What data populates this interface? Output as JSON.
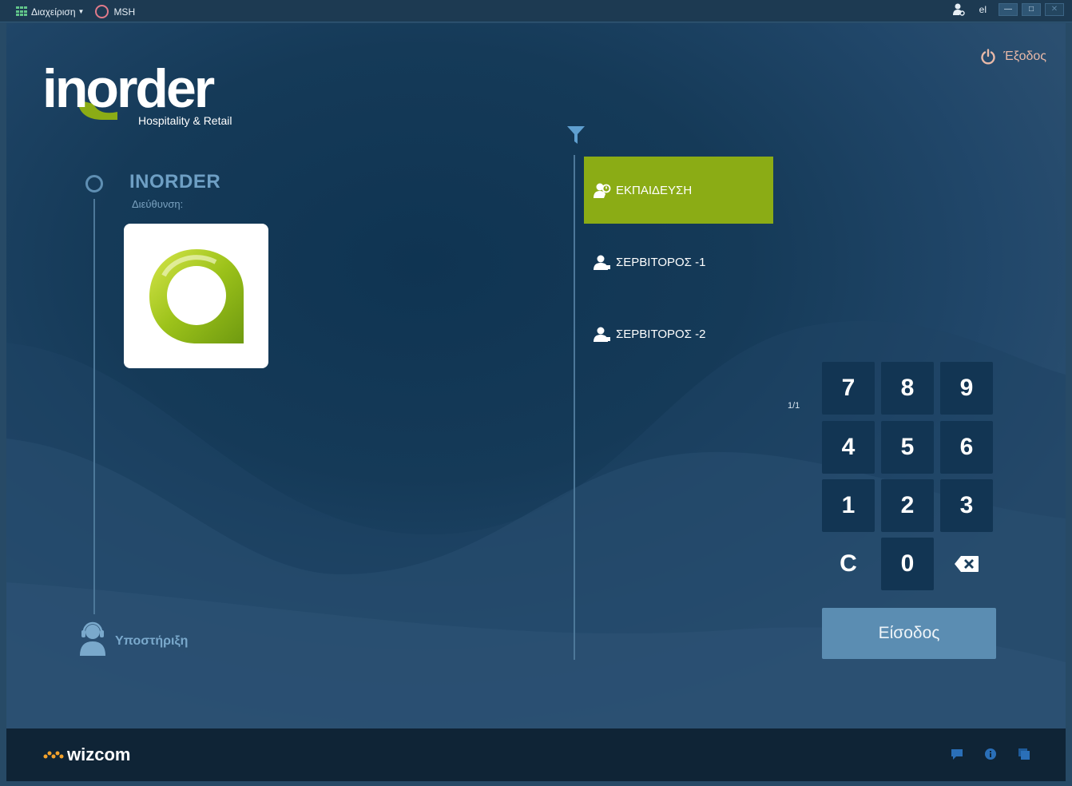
{
  "titlebar": {
    "menu_label": "Διαχείριση",
    "station_label": "MSH",
    "lang": "el",
    "minimize_symbol": "—",
    "maximize_symbol": "□",
    "close_symbol": "✕"
  },
  "brand": {
    "logo_text": "inorder",
    "logo_subtitle": "Hospitality & Retail",
    "accent_color": "#8bac15"
  },
  "header": {
    "exit_label": "Έξοδος"
  },
  "company": {
    "name": "INORDER",
    "address_label": "Διεύθυνση:"
  },
  "support": {
    "label": "Υποστήριξη"
  },
  "users": {
    "items": [
      {
        "label": "ΕΚΠΑΙΔΕΥΣΗ",
        "icon": "trainer-user-icon",
        "selected": true
      },
      {
        "label": "ΣΕΡΒΙΤΟΡΟΣ -1",
        "icon": "user-icon",
        "selected": false
      },
      {
        "label": "ΣΕΡΒΙΤΟΡΟΣ -2",
        "icon": "user-icon",
        "selected": false
      }
    ],
    "page_indicator": "1/1"
  },
  "numpad": {
    "keys": [
      "7",
      "8",
      "9",
      "4",
      "5",
      "6",
      "1",
      "2",
      "3",
      "C",
      "0"
    ],
    "backspace_icon": "backspace-icon"
  },
  "login": {
    "label": "Είσοδος"
  },
  "footer": {
    "brand": "wizcom",
    "icons": [
      "chat-icon",
      "info-icon",
      "windows-icon"
    ]
  }
}
